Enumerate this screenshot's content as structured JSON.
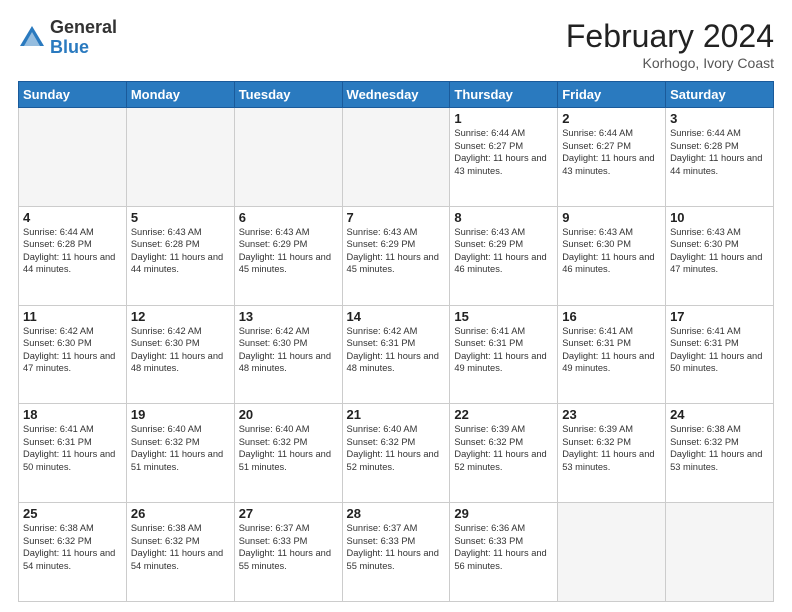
{
  "header": {
    "logo_general": "General",
    "logo_blue": "Blue",
    "month_year": "February 2024",
    "location": "Korhogo, Ivory Coast"
  },
  "weekdays": [
    "Sunday",
    "Monday",
    "Tuesday",
    "Wednesday",
    "Thursday",
    "Friday",
    "Saturday"
  ],
  "weeks": [
    [
      {
        "day": "",
        "info": ""
      },
      {
        "day": "",
        "info": ""
      },
      {
        "day": "",
        "info": ""
      },
      {
        "day": "",
        "info": ""
      },
      {
        "day": "1",
        "info": "Sunrise: 6:44 AM\nSunset: 6:27 PM\nDaylight: 11 hours and 43 minutes."
      },
      {
        "day": "2",
        "info": "Sunrise: 6:44 AM\nSunset: 6:27 PM\nDaylight: 11 hours and 43 minutes."
      },
      {
        "day": "3",
        "info": "Sunrise: 6:44 AM\nSunset: 6:28 PM\nDaylight: 11 hours and 44 minutes."
      }
    ],
    [
      {
        "day": "4",
        "info": "Sunrise: 6:44 AM\nSunset: 6:28 PM\nDaylight: 11 hours and 44 minutes."
      },
      {
        "day": "5",
        "info": "Sunrise: 6:43 AM\nSunset: 6:28 PM\nDaylight: 11 hours and 44 minutes."
      },
      {
        "day": "6",
        "info": "Sunrise: 6:43 AM\nSunset: 6:29 PM\nDaylight: 11 hours and 45 minutes."
      },
      {
        "day": "7",
        "info": "Sunrise: 6:43 AM\nSunset: 6:29 PM\nDaylight: 11 hours and 45 minutes."
      },
      {
        "day": "8",
        "info": "Sunrise: 6:43 AM\nSunset: 6:29 PM\nDaylight: 11 hours and 46 minutes."
      },
      {
        "day": "9",
        "info": "Sunrise: 6:43 AM\nSunset: 6:30 PM\nDaylight: 11 hours and 46 minutes."
      },
      {
        "day": "10",
        "info": "Sunrise: 6:43 AM\nSunset: 6:30 PM\nDaylight: 11 hours and 47 minutes."
      }
    ],
    [
      {
        "day": "11",
        "info": "Sunrise: 6:42 AM\nSunset: 6:30 PM\nDaylight: 11 hours and 47 minutes."
      },
      {
        "day": "12",
        "info": "Sunrise: 6:42 AM\nSunset: 6:30 PM\nDaylight: 11 hours and 48 minutes."
      },
      {
        "day": "13",
        "info": "Sunrise: 6:42 AM\nSunset: 6:30 PM\nDaylight: 11 hours and 48 minutes."
      },
      {
        "day": "14",
        "info": "Sunrise: 6:42 AM\nSunset: 6:31 PM\nDaylight: 11 hours and 48 minutes."
      },
      {
        "day": "15",
        "info": "Sunrise: 6:41 AM\nSunset: 6:31 PM\nDaylight: 11 hours and 49 minutes."
      },
      {
        "day": "16",
        "info": "Sunrise: 6:41 AM\nSunset: 6:31 PM\nDaylight: 11 hours and 49 minutes."
      },
      {
        "day": "17",
        "info": "Sunrise: 6:41 AM\nSunset: 6:31 PM\nDaylight: 11 hours and 50 minutes."
      }
    ],
    [
      {
        "day": "18",
        "info": "Sunrise: 6:41 AM\nSunset: 6:31 PM\nDaylight: 11 hours and 50 minutes."
      },
      {
        "day": "19",
        "info": "Sunrise: 6:40 AM\nSunset: 6:32 PM\nDaylight: 11 hours and 51 minutes."
      },
      {
        "day": "20",
        "info": "Sunrise: 6:40 AM\nSunset: 6:32 PM\nDaylight: 11 hours and 51 minutes."
      },
      {
        "day": "21",
        "info": "Sunrise: 6:40 AM\nSunset: 6:32 PM\nDaylight: 11 hours and 52 minutes."
      },
      {
        "day": "22",
        "info": "Sunrise: 6:39 AM\nSunset: 6:32 PM\nDaylight: 11 hours and 52 minutes."
      },
      {
        "day": "23",
        "info": "Sunrise: 6:39 AM\nSunset: 6:32 PM\nDaylight: 11 hours and 53 minutes."
      },
      {
        "day": "24",
        "info": "Sunrise: 6:38 AM\nSunset: 6:32 PM\nDaylight: 11 hours and 53 minutes."
      }
    ],
    [
      {
        "day": "25",
        "info": "Sunrise: 6:38 AM\nSunset: 6:32 PM\nDaylight: 11 hours and 54 minutes."
      },
      {
        "day": "26",
        "info": "Sunrise: 6:38 AM\nSunset: 6:32 PM\nDaylight: 11 hours and 54 minutes."
      },
      {
        "day": "27",
        "info": "Sunrise: 6:37 AM\nSunset: 6:33 PM\nDaylight: 11 hours and 55 minutes."
      },
      {
        "day": "28",
        "info": "Sunrise: 6:37 AM\nSunset: 6:33 PM\nDaylight: 11 hours and 55 minutes."
      },
      {
        "day": "29",
        "info": "Sunrise: 6:36 AM\nSunset: 6:33 PM\nDaylight: 11 hours and 56 minutes."
      },
      {
        "day": "",
        "info": ""
      },
      {
        "day": "",
        "info": ""
      }
    ]
  ]
}
